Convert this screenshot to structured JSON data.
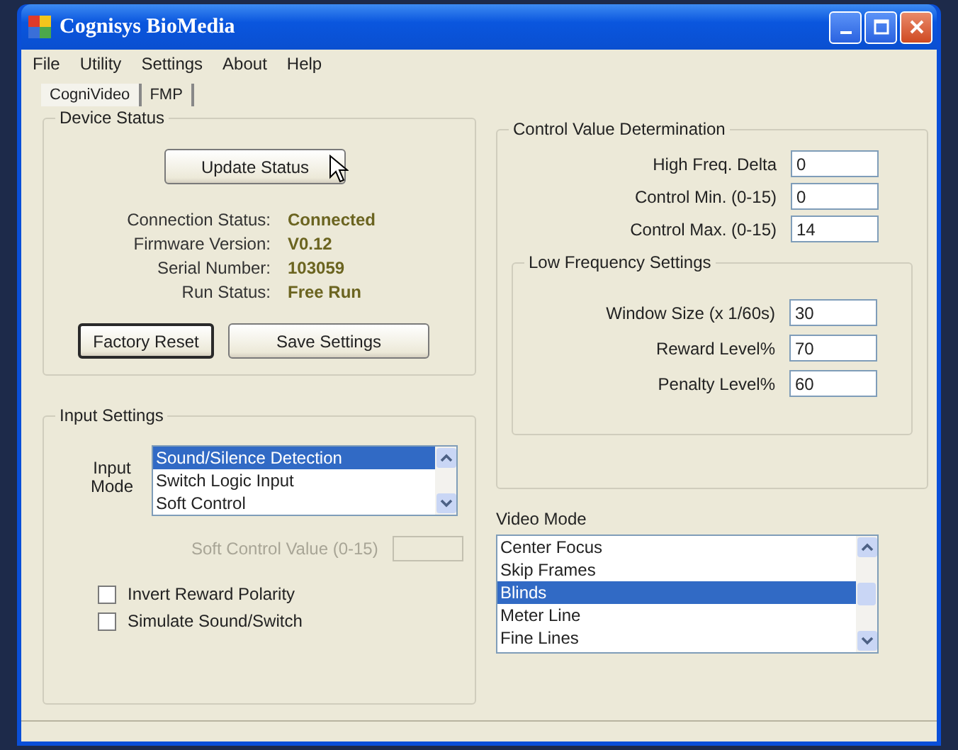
{
  "window": {
    "title": "Cognisys BioMedia"
  },
  "menu": [
    "File",
    "Utility",
    "Settings",
    "About",
    "Help"
  ],
  "tabs": [
    {
      "label": "CogniVideo",
      "selected": true
    },
    {
      "label": "FMP",
      "selected": false
    }
  ],
  "device_status": {
    "title": "Device Status",
    "update_button": "Update Status",
    "fields": [
      {
        "label": "Connection Status:",
        "value": "Connected"
      },
      {
        "label": "Firmware Version:",
        "value": "V0.12"
      },
      {
        "label": "Serial Number:",
        "value": "103059"
      },
      {
        "label": "Run Status:",
        "value": "Free Run"
      }
    ],
    "buttons": [
      {
        "label": "Factory Reset",
        "default": true
      },
      {
        "label": "Save Settings",
        "default": false
      }
    ]
  },
  "input_settings": {
    "title": "Input Settings",
    "input_mode_label": "Input Mode",
    "items": [
      {
        "label": "Sound/Silence Detection",
        "selected": true
      },
      {
        "label": "Switch Logic Input",
        "selected": false
      },
      {
        "label": "Soft Control",
        "selected": false
      }
    ],
    "soft_control": {
      "label": "Soft Control Value (0-15)",
      "disabled": true
    },
    "checkboxes": [
      {
        "label": "Invert Reward Polarity",
        "checked": false
      },
      {
        "label": "Simulate Sound/Switch",
        "checked": false
      }
    ]
  },
  "control_value": {
    "title": "Control Value Determination",
    "fields": [
      {
        "label": "High Freq. Delta",
        "value": "0"
      },
      {
        "label": "Control Min. (0-15)",
        "value": "0"
      },
      {
        "label": "Control Max. (0-15)",
        "value": "14"
      }
    ],
    "low_frequency": {
      "title": "Low Frequency Settings",
      "fields": [
        {
          "label": "Window Size (x 1/60s)",
          "value": "30"
        },
        {
          "label": "Reward Level%",
          "value": "70"
        },
        {
          "label": "Penalty Level%",
          "value": "60"
        }
      ]
    }
  },
  "video_mode": {
    "label": "Video Mode",
    "items": [
      {
        "label": "Center Focus",
        "selected": false
      },
      {
        "label": "Skip Frames",
        "selected": false
      },
      {
        "label": "Blinds",
        "selected": true
      },
      {
        "label": "Meter Line",
        "selected": false
      },
      {
        "label": "Fine Lines",
        "selected": false
      }
    ]
  }
}
